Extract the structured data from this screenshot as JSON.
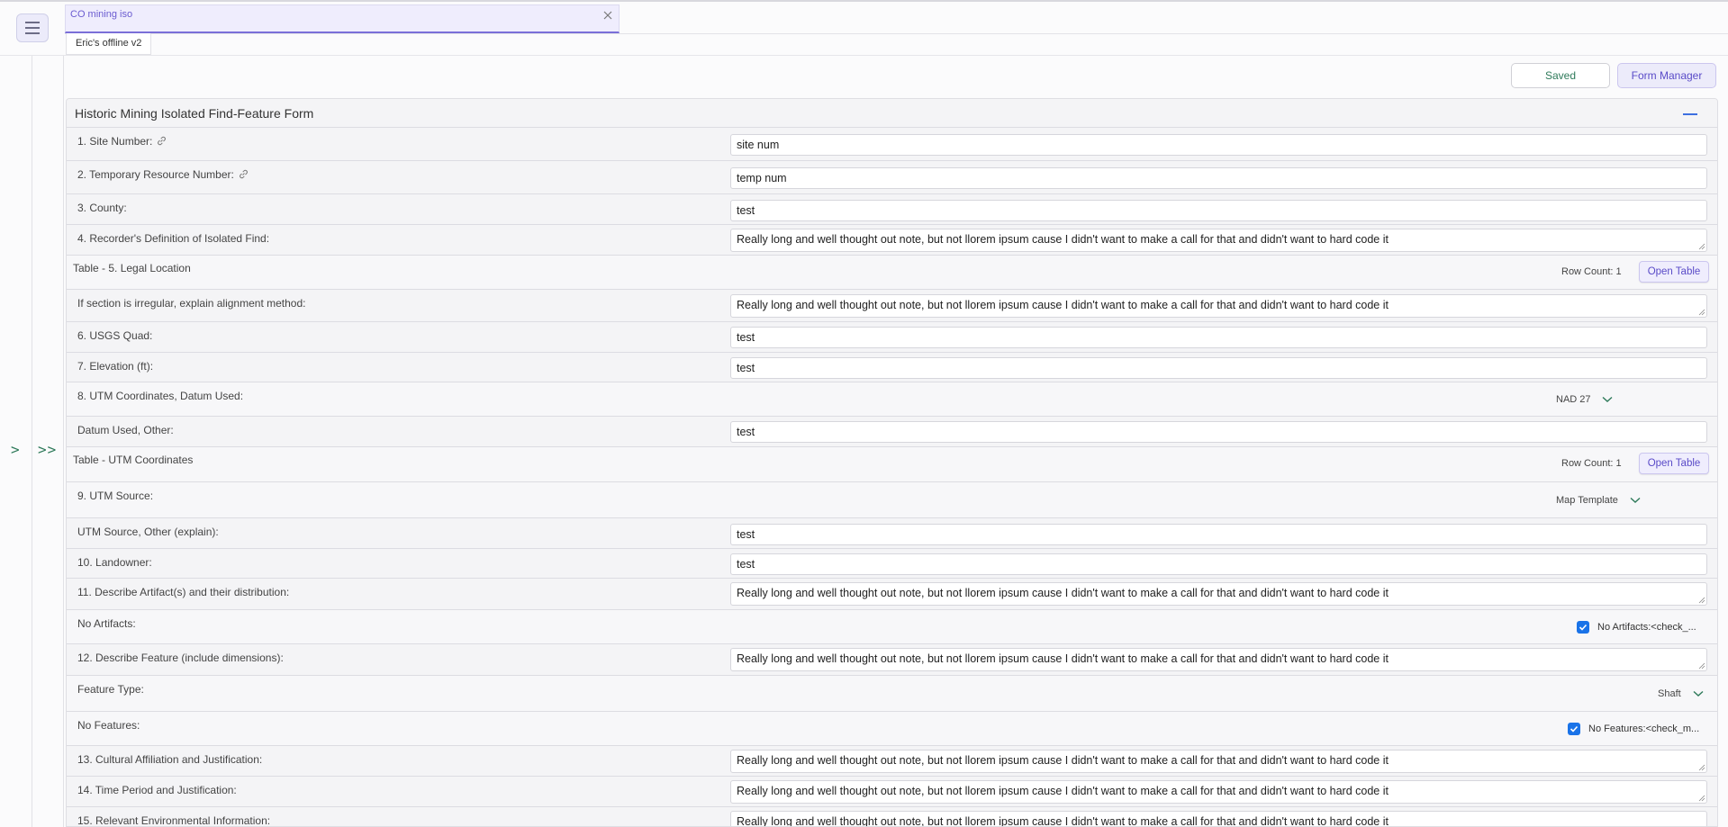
{
  "tabs": {
    "active": "CO mining iso",
    "sub": "Eric's offline v2"
  },
  "rail": {
    "expand_one": ">",
    "expand_all": ">>"
  },
  "toolbar": {
    "saved": "Saved",
    "form_manager": "Form Manager"
  },
  "form": {
    "title": "Historic Mining Isolated Find-Feature Form",
    "rows": [
      {
        "label": "1. Site Number:",
        "value": "site num"
      },
      {
        "label": "2. Temporary Resource Number:",
        "value": "temp num"
      },
      {
        "label": "3. County:",
        "value": "test"
      },
      {
        "label": "4. Recorder's Definition of Isolated Find:",
        "value": "Really long and well thought out note, but not llorem ipsum cause I didn't want to make a call for that and didn't want to hard code it"
      },
      {
        "label": "Table - 5. Legal Location",
        "row_count": "Row Count: 1",
        "button": "Open Table"
      },
      {
        "label": "If section is irregular, explain alignment method:",
        "value": "Really long and well thought out note, but not llorem ipsum cause I didn't want to make a call for that and didn't want to hard code it"
      },
      {
        "label": "6. USGS Quad:",
        "value": "test"
      },
      {
        "label": "7. Elevation (ft):",
        "value": "test"
      },
      {
        "label": "8. UTM Coordinates, Datum Used:",
        "select": "NAD 27"
      },
      {
        "label": "Datum Used, Other:",
        "value": "test"
      },
      {
        "label": "Table - UTM Coordinates",
        "row_count": "Row Count: 1",
        "button": "Open Table"
      },
      {
        "label": "9. UTM Source:",
        "select": "Map Template"
      },
      {
        "label": "UTM Source, Other (explain):",
        "value": "test"
      },
      {
        "label": "10. Landowner:",
        "value": "test"
      },
      {
        "label": "11. Describe Artifact(s) and their distribution:",
        "value": "Really long and well thought out note, but not llorem ipsum cause I didn't want to make a call for that and didn't want to hard code it"
      },
      {
        "label": "No Artifacts:",
        "checkbox": "No Artifacts:<check_..."
      },
      {
        "label": "12. Describe Feature (include dimensions):",
        "value": "Really long and well thought out note, but not llorem ipsum cause I didn't want to make a call for that and didn't want to hard code it"
      },
      {
        "label": "Feature Type:",
        "select": "Shaft"
      },
      {
        "label": "No Features:",
        "checkbox": "No Features:<check_m..."
      },
      {
        "label": "13. Cultural Affiliation and Justification:",
        "value": "Really long and well thought out note, but not llorem ipsum cause I didn't want to make a call for that and didn't want to hard code it"
      },
      {
        "label": "14. Time Period and Justification:",
        "value": "Really long and well thought out note, but not llorem ipsum cause I didn't want to make a call for that and didn't want to hard code it"
      },
      {
        "label": "15. Relevant Environmental Information:",
        "value": "Really long and well thought out note, but not llorem ipsum cause I didn't want to make a call for that and didn't want to hard code it"
      }
    ]
  },
  "colors": {
    "accent": "#7a6fd8",
    "green": "#2e7a5a",
    "checkbox": "#1a73e8"
  }
}
